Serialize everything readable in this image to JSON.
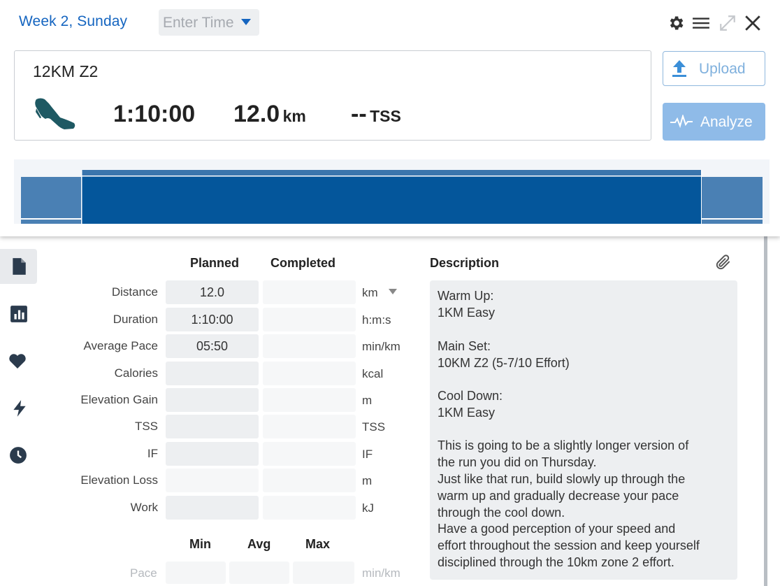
{
  "header": {
    "title": "Week 2, Sunday",
    "time_placeholder": "Enter Time",
    "icons": [
      "gear-icon",
      "menu-icon",
      "expand-icon",
      "close-icon"
    ]
  },
  "workout": {
    "name": "12KM Z2",
    "sport_icon": "running-shoe-icon",
    "duration": "1:10:00",
    "distance_value": "12.0",
    "distance_unit": "km",
    "tss_value": "--",
    "tss_unit": "TSS"
  },
  "actions": {
    "upload_label": "Upload",
    "analyze_label": "Analyze"
  },
  "sidebar": {
    "icons": [
      "document-icon",
      "bar-chart-icon",
      "heart-icon",
      "lightning-icon",
      "clock-icon"
    ]
  },
  "table": {
    "planned_header": "Planned",
    "completed_header": "Completed",
    "rows": [
      {
        "label": "Distance",
        "planned": "12.0",
        "completed": "",
        "unit": "km"
      },
      {
        "label": "Duration",
        "planned": "1:10:00",
        "completed": "",
        "unit": "h:m:s"
      },
      {
        "label": "Average Pace",
        "planned": "05:50",
        "completed": "",
        "unit": "min/km"
      },
      {
        "label": "Calories",
        "planned": "",
        "completed": "",
        "unit": "kcal"
      },
      {
        "label": "Elevation Gain",
        "planned": "",
        "completed": "",
        "unit": "m"
      },
      {
        "label": "TSS",
        "planned": "",
        "completed": "",
        "unit": "TSS"
      },
      {
        "label": "IF",
        "planned": "",
        "completed": "",
        "unit": "IF"
      },
      {
        "label": "Elevation Loss",
        "planned": "",
        "completed": "",
        "unit": "m"
      },
      {
        "label": "Work",
        "planned": "",
        "completed": "",
        "unit": "kJ"
      }
    ]
  },
  "minmax": {
    "min_header": "Min",
    "avg_header": "Avg",
    "max_header": "Max",
    "pace_label": "Pace",
    "pace_unit": "min/km"
  },
  "description": {
    "heading": "Description",
    "lines": [
      "Warm Up:",
      "1KM Easy",
      "",
      "Main Set:",
      "10KM Z2 (5-7/10 Effort)",
      "",
      "Cool Down:",
      "1KM Easy",
      "",
      "This is going to be a slightly longer version of",
      "the run you did on Thursday.",
      "Just like that run, build slowly up through the",
      "warm up and gradually decrease your pace",
      "through the cool down.",
      "Have a good perception of your speed and",
      "effort throughout the session and keep yourself",
      "disciplined through the 10km zone 2 effort."
    ]
  },
  "colors": {
    "accent": "#1565c0",
    "graph_main": "#04569b",
    "graph_light": "#4a80b4",
    "analyze_bg": "#8fbbe8"
  }
}
